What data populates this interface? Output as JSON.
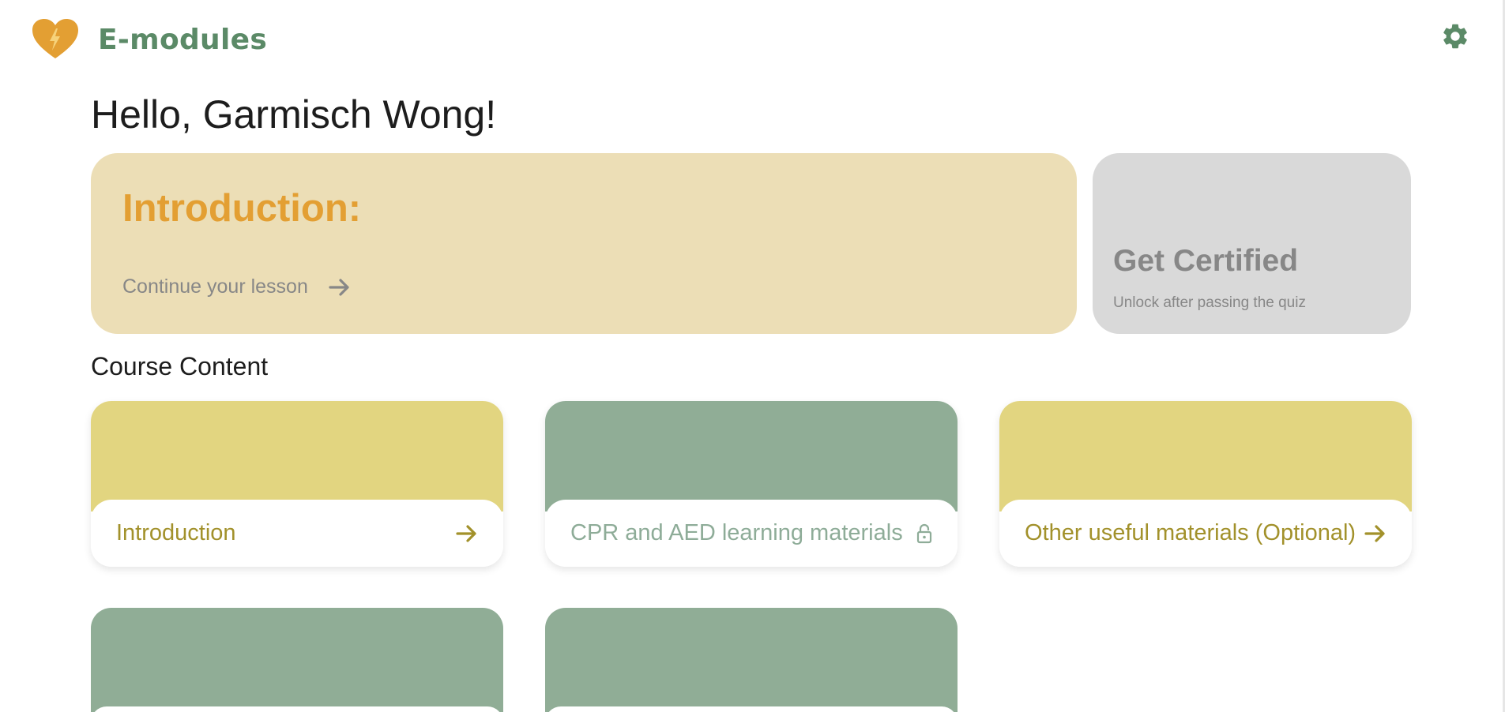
{
  "app": {
    "brand": "E-modules",
    "logo_icon": "heart-lightning-icon",
    "settings_icon": "gear-icon"
  },
  "colors": {
    "brand_green": "#5b8a67",
    "accent_orange": "#e39f33",
    "hero_bg": "#ecdeb6",
    "locked_bg": "#d9d9d9",
    "yellow_banner": "#e2d580",
    "green_banner": "#90ad96",
    "yellow_text": "#a2912b",
    "green_text": "#8eac98"
  },
  "greeting": "Hello, Garmisch Wong!",
  "hero": {
    "title": "Introduction:",
    "continue_label": "Continue your lesson",
    "continue_icon": "arrow-right-icon"
  },
  "certificate": {
    "title": "Get Certified",
    "subtitle": "Unlock after passing the quiz"
  },
  "course": {
    "section_title": "Course Content",
    "modules": [
      {
        "label": "Introduction",
        "state": "unlocked",
        "icon": "arrow-right-icon"
      },
      {
        "label": "CPR and AED learning materials",
        "state": "locked",
        "icon": "lock-icon"
      },
      {
        "label": "Other useful materials (Optional)",
        "state": "unlocked",
        "icon": "arrow-right-icon"
      },
      {
        "label": "",
        "state": "locked",
        "icon": ""
      },
      {
        "label": "",
        "state": "locked",
        "icon": ""
      }
    ]
  }
}
